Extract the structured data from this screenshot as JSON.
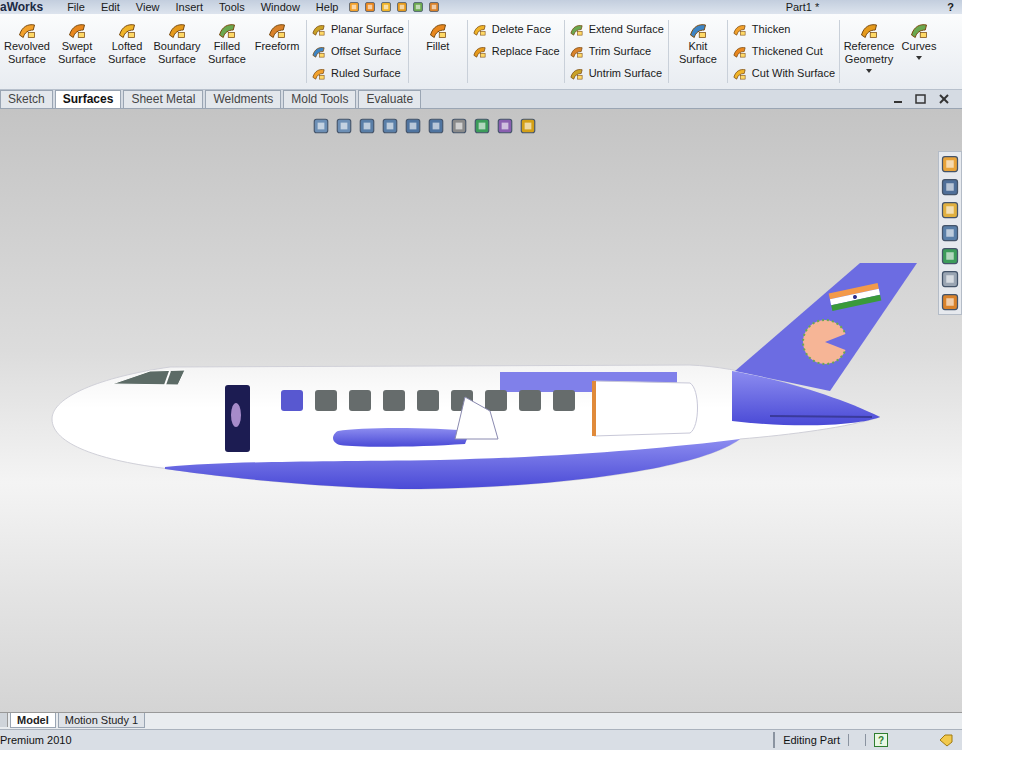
{
  "window": {
    "app_name": "aWorks",
    "title": "Part1 *",
    "help": "?"
  },
  "menu": [
    "File",
    "Edit",
    "View",
    "Insert",
    "Tools",
    "Window",
    "Help"
  ],
  "ribbon": [
    {
      "kind": "large",
      "items": [
        "Revolved Surface",
        "Swept Surface",
        "Lofted Surface",
        "Boundary Surface",
        "Filled Surface",
        "Freeform"
      ]
    },
    {
      "kind": "stack",
      "items": [
        "Planar Surface",
        "Offset Surface",
        "Ruled Surface"
      ]
    },
    {
      "kind": "large",
      "items": [
        "Fillet"
      ]
    },
    {
      "kind": "stack",
      "items": [
        "Delete Face",
        "Replace Face"
      ]
    },
    {
      "kind": "stack",
      "items": [
        "Extend Surface",
        "Trim Surface",
        "Untrim Surface"
      ]
    },
    {
      "kind": "large",
      "items": [
        "Knit Surface"
      ]
    },
    {
      "kind": "stack",
      "items": [
        "Thicken",
        "Thickened Cut",
        "Cut With Surface"
      ]
    },
    {
      "kind": "large",
      "items": [
        "Reference Geometry",
        "Curves"
      ]
    }
  ],
  "tabs": [
    {
      "label": "Sketch",
      "selected": false
    },
    {
      "label": "Surfaces",
      "selected": true
    },
    {
      "label": "Sheet Metal",
      "selected": false
    },
    {
      "label": "Weldments",
      "selected": false
    },
    {
      "label": "Mold Tools",
      "selected": false
    },
    {
      "label": "Evaluate",
      "selected": false
    }
  ],
  "bottom_tabs": [
    {
      "label": "Model",
      "selected": true
    },
    {
      "label": "Motion Study 1",
      "selected": false
    }
  ],
  "status_bar": {
    "edition": "Premium 2010",
    "mode": "Editing Part",
    "help": "?"
  }
}
